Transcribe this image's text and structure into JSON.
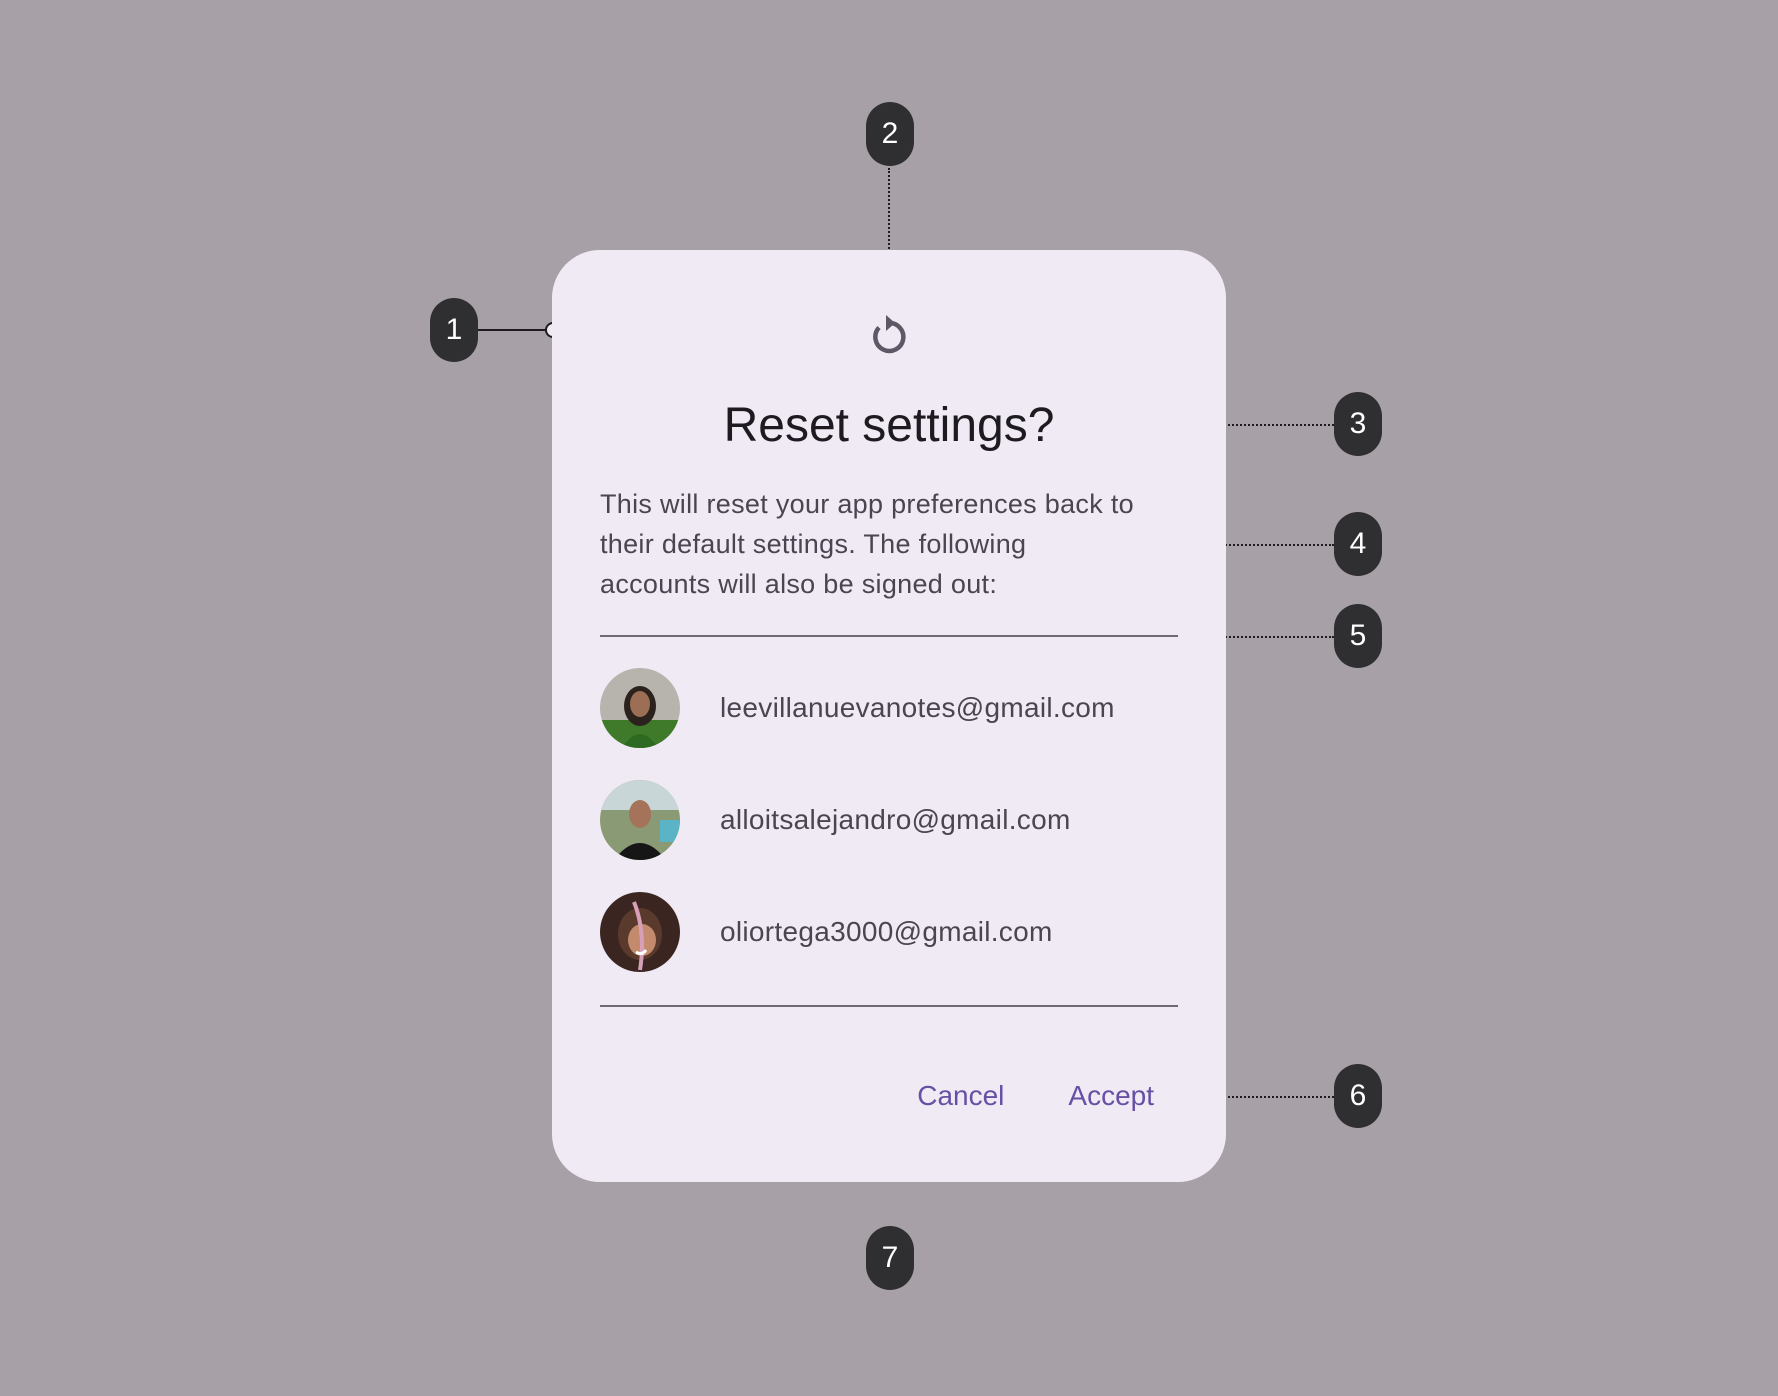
{
  "dialog": {
    "icon": "reset-icon",
    "title": "Reset settings?",
    "body": "This will reset your app preferences back to their default settings. The following accounts will also be signed out:",
    "accounts": [
      {
        "email": "leevillanuevanotes@gmail.com",
        "avatar": "avatar-photo"
      },
      {
        "email": "alloitsalejandro@gmail.com",
        "avatar": "avatar-photo"
      },
      {
        "email": "oliortega3000@gmail.com",
        "avatar": "avatar-photo"
      }
    ],
    "cancel_label": "Cancel",
    "accept_label": "Accept"
  },
  "annotations": {
    "m1": "1",
    "m2": "2",
    "m3": "3",
    "m4": "4",
    "m5": "5",
    "m6": "6",
    "m7": "7"
  },
  "colors": {
    "background": "#a7a0a6",
    "surface": "#f0eaf5",
    "primary": "#6750a4",
    "on_surface": "#1d1b20",
    "on_surface_variant": "#4a4550",
    "marker": "#2f2e31"
  }
}
